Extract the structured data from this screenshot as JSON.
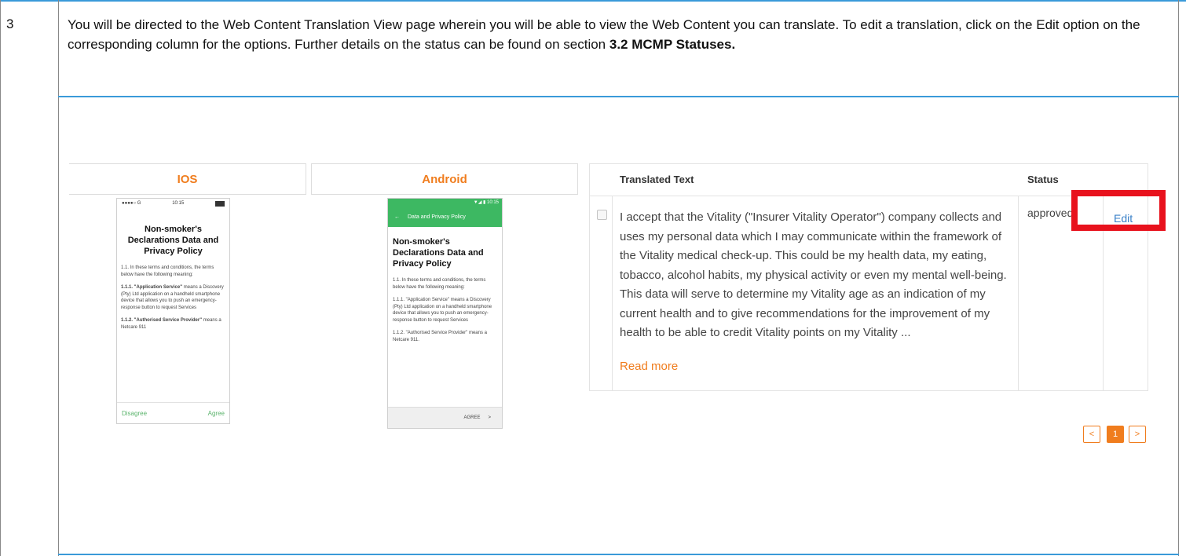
{
  "step": {
    "number": "3",
    "text_before": "You will be directed to the Web Content Translation View page wherein you will be able to view the Web Content you can translate. To edit a translation, click on the Edit option on the corresponding column for the options. Further details on the status can be found on section ",
    "text_bold": "3.2 MCMP Statuses."
  },
  "ios": {
    "header": "IOS",
    "status_left": "●●●●○ G",
    "status_time": "10:15",
    "title": "Non-smoker's Declarations Data and Privacy Policy",
    "para1": "1.1. In these terms and conditions, the terms below have the following meaning:",
    "para2_bold": "1.1.1. \"Application Service\"",
    "para2": " means a Discovery (Pty) Ltd application on a handheld smartphone device that allows you to push an emergency-response button to request Services",
    "para3_bold": "1.1.2. \"Authorised Service Provider\"",
    "para3": " means a Netcare 911",
    "disagree": "Disagree",
    "agree": "Agree"
  },
  "android": {
    "header": "Android",
    "status": "▼◢ ▮ 10:15",
    "back_arrow": "←",
    "bar_title": "Data and Privacy Policy",
    "title": "Non-smoker's Declarations Data and Privacy Policy",
    "para1": "1.1. In these terms and conditions, the terms below have the following meaning:",
    "para2": "1.1.1. \"Application Service\" means a Discovery (Pty) Ltd application on a handheld smartphone device that allows you to push an emergency-response button to request Services",
    "para3": "1.1.2. \"Authorised Service Provider\" means a Netcare 911.",
    "agree": "AGREE",
    "chevron": ">"
  },
  "table": {
    "col_text": "Translated Text",
    "col_status": "Status",
    "row_text": "I accept that the Vitality (\"Insurer Vitality Operator\") company collects and uses my personal data which I may communicate within the framework of the Vitality medical check-up. This could be my health data, my eating, tobacco, alcohol habits, my physical activity or even my mental well-being. This data will serve to determine my Vitality age as an indication of my current health and to give recommendations for the improvement of my health to be able to credit Vitality points on my Vitality ...",
    "read_more": "Read more",
    "status": "approved",
    "edit": "Edit"
  },
  "pagination": {
    "prev": "<",
    "current": "1",
    "next": ">"
  },
  "colors": {
    "accent_orange": "#f07d1e",
    "highlight_red": "#e8121d",
    "rule_blue": "#3a9ad9",
    "link_blue": "#3a80c8",
    "android_green": "#3db862"
  }
}
